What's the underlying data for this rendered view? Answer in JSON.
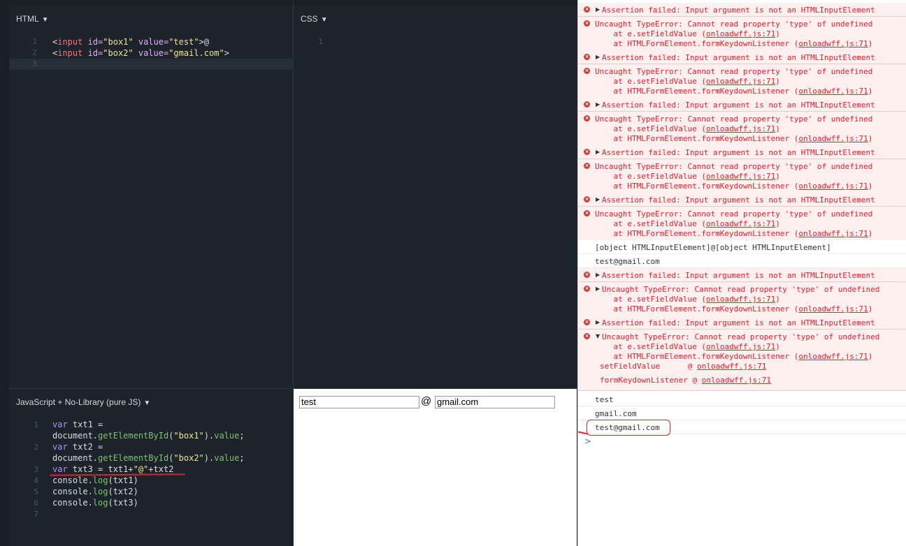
{
  "editors": {
    "html": {
      "header": "HTML",
      "line_numbers": [
        "1",
        "2",
        "3"
      ],
      "line1": {
        "open": "<",
        "tag": "input",
        "a1": " id=",
        "v1": "\"box1\"",
        "a2": " value=",
        "v2": "\"test\"",
        "close": ">",
        "at": "@"
      },
      "line2": {
        "open": "<",
        "tag": "input",
        "a1": " id=",
        "v1": "\"box2\"",
        "a2": " value=",
        "v2": "\"gmail.com\"",
        "close": ">"
      }
    },
    "css": {
      "header": "CSS",
      "line_numbers": [
        "1"
      ]
    },
    "js": {
      "header": "JavaScript + No-Library (pure JS)",
      "line_numbers": [
        "1",
        "2",
        "3",
        "4",
        "5",
        "6",
        "7"
      ],
      "l1a": "var",
      "l1b": " txt1 =",
      "l1c": "document.",
      "l1d": "getElementById",
      "l1e": "(",
      "l1f": "\"box1\"",
      "l1g": ").",
      "l1h": "value",
      "l1i": ";",
      "l2a": "var",
      "l2b": " txt2 =",
      "l2c": "document.",
      "l2d": "getElementById",
      "l2e": "(",
      "l2f": "\"box2\"",
      "l2g": ").",
      "l2h": "value",
      "l2i": ";",
      "l3a": "var",
      "l3b": " txt3 = ",
      "l3c": "txt1+",
      "l3d": "\"@\"",
      "l3e": "+txt2",
      "l4a": "console.",
      "l4b": "log",
      "l4c": "(txt1)",
      "l5a": "console.",
      "l5b": "log",
      "l5c": "(txt2)",
      "l6a": "console.",
      "l6b": "log",
      "l6c": "(txt3)"
    }
  },
  "output": {
    "box1_value": "test",
    "at": "@",
    "box2_value": "gmail.com"
  },
  "console": {
    "assert": "Assertion failed: Input argument is not an HTMLInputElement",
    "type_error": "Uncaught TypeError: Cannot read property 'type' of undefined",
    "at1_pre": "    at e.setFieldValue (",
    "at2_pre": "    at HTMLFormElement.formKeydownListener (",
    "link": "onloadwff.js:71",
    "close": ")",
    "obj_line": "[object HTMLInputElement]@[object HTMLInputElement]",
    "result1": "test@gmail.com",
    "stack_fn1": "setFieldValue      @ ",
    "stack_fn2": "formKeydownListener @ ",
    "log1": "test",
    "log2": "gmail.com",
    "log3": "test@gmail.com",
    "prompt": ">"
  },
  "colors": {
    "editor_bg": "#1d232a",
    "error_bg": "#fff0f0",
    "error_text": "#e0202a",
    "annotation": "#e0202a"
  }
}
